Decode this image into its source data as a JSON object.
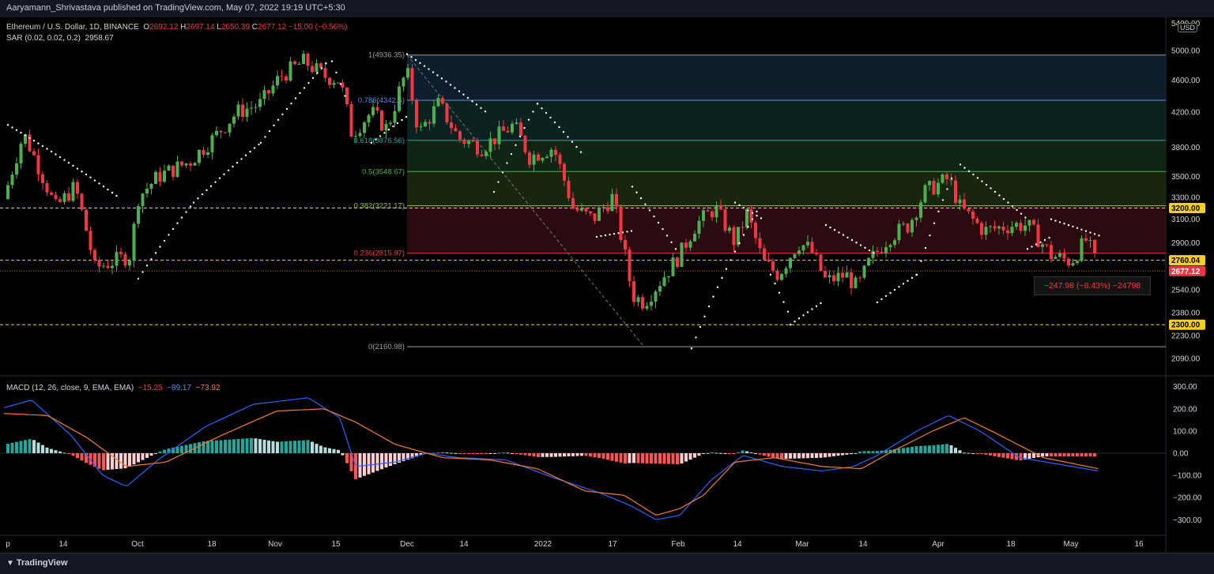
{
  "header": {
    "published_by": "Aaryamann_Shrivastava published on TradingView.com, May 07, 2022 19:19 UTC+5:30"
  },
  "legend": {
    "symbol": "Ethereum / U.S. Dollar, 1D, BINANCE",
    "ohlc": {
      "o_label": "O",
      "o": "2692.12",
      "h_label": "H",
      "h": "2697.14",
      "l_label": "L",
      "l": "2650.39",
      "c_label": "C",
      "c": "2677.12",
      "chg": "−15.00 (−0.56%)"
    },
    "sar": {
      "label": "SAR (0.02, 0.02, 0.2)",
      "value": "2958.67"
    },
    "macd": {
      "label": "MACD (12, 26, close, 9, EMA, EMA)",
      "hist": "−15.25",
      "macd": "−89.17",
      "signal": "−73.92"
    }
  },
  "currency_badge": "USD",
  "change_box": "−247.98 (−8.43%) −24798",
  "footer": {
    "brand": "TradingView"
  },
  "chart_data": {
    "type": "candlestick",
    "price_axis": {
      "ticks": [
        "5400.00",
        "5000.00",
        "4600.00",
        "4200.00",
        "3800.00",
        "3500.00",
        "3300.00",
        "3100.00",
        "2900.00",
        "2540.00",
        "2380.00",
        "2230.00",
        "2090.00"
      ],
      "scale": "log",
      "badges": [
        {
          "value": "3200.00",
          "text": "3200.00",
          "color": "#f5d020"
        },
        {
          "value": "2760.04",
          "text": "2760.04",
          "color": "#f5d020"
        },
        {
          "value": "2677.12",
          "text": "2677.12",
          "color": "#f23645"
        },
        {
          "value": "2300.00",
          "text": "2300.00",
          "color": "#f5d020"
        }
      ]
    },
    "time_axis": {
      "labels": [
        "p",
        "14",
        "Oct",
        "18",
        "Nov",
        "15",
        "Dec",
        "14",
        "2022",
        "17",
        "Feb",
        "14",
        "Mar",
        "14",
        "Apr",
        "18",
        "May",
        "16"
      ]
    },
    "horizontal_levels": [
      3200,
      2760.04,
      2300
    ],
    "fibonacci": [
      {
        "ratio": "1",
        "price": 4936.35,
        "label": "1(4936.35)",
        "color": "#9e9e9e",
        "fill": "#1c1c1c"
      },
      {
        "ratio": "0.786",
        "price": 4342.4,
        "label": "0.786(4342.4)",
        "color": "#5b8bf5",
        "fill": "#0f1e2c"
      },
      {
        "ratio": "0.618",
        "price": 3876.56,
        "label": "0.618(3876.56)",
        "color": "#26a69a",
        "fill": "#0c2220"
      },
      {
        "ratio": "0.5",
        "price": 3548.67,
        "label": "0.5(3548.67)",
        "color": "#4caf50",
        "fill": "#112515"
      },
      {
        "ratio": "0.382",
        "price": 3221.17,
        "label": "0.382(3221.17)",
        "color": "#8bc34a",
        "fill": "#18250f"
      },
      {
        "ratio": "0.236",
        "price": 2815.97,
        "label": "0.236(2815.97)",
        "color": "#f23645",
        "fill": "#2a0b10"
      },
      {
        "ratio": "0",
        "price": 2160.98,
        "label": "0(2160.98)",
        "color": "#9e9e9e",
        "fill": null
      }
    ],
    "key_prices": {
      "all_time_high_approx": 4890,
      "low_approx": 2160,
      "last": 2677.12
    },
    "macd_axis": {
      "ticks": [
        "300.00",
        "200.00",
        "100.00",
        "0.00",
        "−100.00",
        "−200.00",
        "−300.00"
      ]
    },
    "colors": {
      "up": "#4caf50",
      "down": "#f23645",
      "sar": "#ffffff",
      "macd": "#2962ff",
      "signal": "#f57c2b",
      "level": "#f5d020"
    }
  }
}
